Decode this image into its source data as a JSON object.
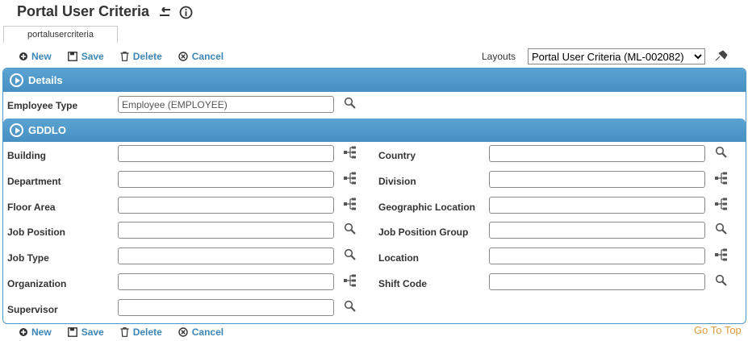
{
  "page": {
    "title": "Portal User Criteria"
  },
  "tab": {
    "label": "portalusercriteria"
  },
  "toolbar": {
    "new": "New",
    "save": "Save",
    "delete": "Delete",
    "cancel": "Cancel"
  },
  "layouts": {
    "label": "Layouts",
    "selected": "Portal User Criteria (ML-002082)"
  },
  "details": {
    "title": "Details",
    "employee_type": {
      "label": "Employee Type",
      "value": "Employee (EMPLOYEE)"
    }
  },
  "gddlo": {
    "title": "GDDLO",
    "left": [
      {
        "label": "Building",
        "icon": "tree-icon"
      },
      {
        "label": "Department",
        "icon": "tree-icon"
      },
      {
        "label": "Floor Area",
        "icon": "tree-icon"
      },
      {
        "label": "Job Position",
        "icon": "search-icon"
      },
      {
        "label": "Job Type",
        "icon": "search-icon"
      },
      {
        "label": "Organization",
        "icon": "tree-icon"
      },
      {
        "label": "Supervisor",
        "icon": "search-icon"
      }
    ],
    "right": [
      {
        "label": "Country",
        "icon": "search-icon"
      },
      {
        "label": "Division",
        "icon": "tree-icon"
      },
      {
        "label": "Geographic Location",
        "icon": "tree-icon"
      },
      {
        "label": "Job Position Group",
        "icon": "search-icon"
      },
      {
        "label": "Location",
        "icon": "tree-icon"
      },
      {
        "label": "Shift Code",
        "icon": "search-icon"
      }
    ]
  },
  "footer": {
    "goto_top": "Go To Top"
  }
}
